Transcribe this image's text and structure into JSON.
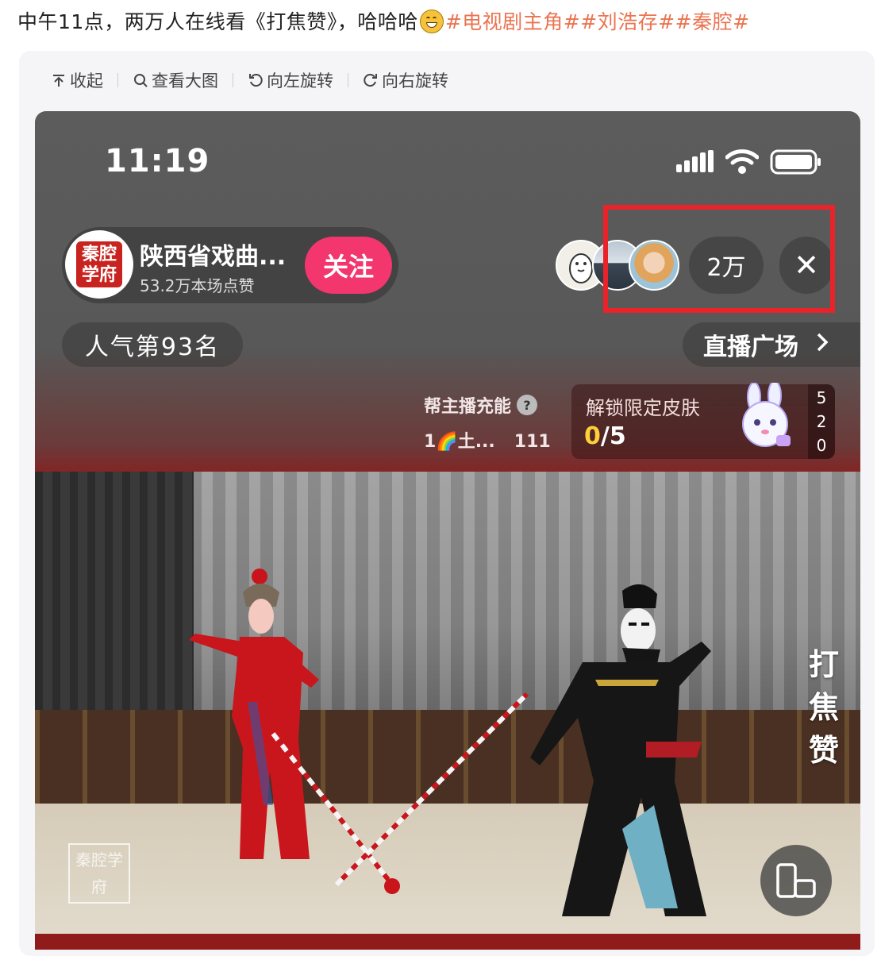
{
  "post": {
    "caption_text": "中午11点，两万人在线看《打焦赞》，哈哈哈",
    "emoji": "grinning-face",
    "hashtags": "#电视剧主角##刘浩存##秦腔#"
  },
  "toolbar": {
    "collapse": "收起",
    "view_large": "查看大图",
    "rotate_left": "向左旋转",
    "rotate_right": "向右旋转"
  },
  "phone": {
    "time": "11:19",
    "anchor": {
      "avatar_seal": "秦腔学府",
      "name": "陕西省戏曲...",
      "likes": "53.2万本场点赞",
      "follow": "关注"
    },
    "viewers": {
      "count": "2万",
      "close": "✕"
    },
    "rank": "人气第93名",
    "plaza": "直播广场",
    "energy": {
      "title": "帮主播充能",
      "rank_text": "1🌈土...",
      "value": "111"
    },
    "skin": {
      "title": "解锁限定皮肤",
      "progress_current": "0",
      "progress_total": "/5",
      "side": [
        "5",
        "2",
        "0"
      ]
    },
    "video": {
      "play_title": [
        "打",
        "焦",
        "赞"
      ],
      "watermark": "秦腔学府"
    }
  },
  "colors": {
    "accent_pink": "#f3366e",
    "hashtag": "#eb7350",
    "highlight": "#e8242a",
    "live_red": "#8f1b1b"
  }
}
